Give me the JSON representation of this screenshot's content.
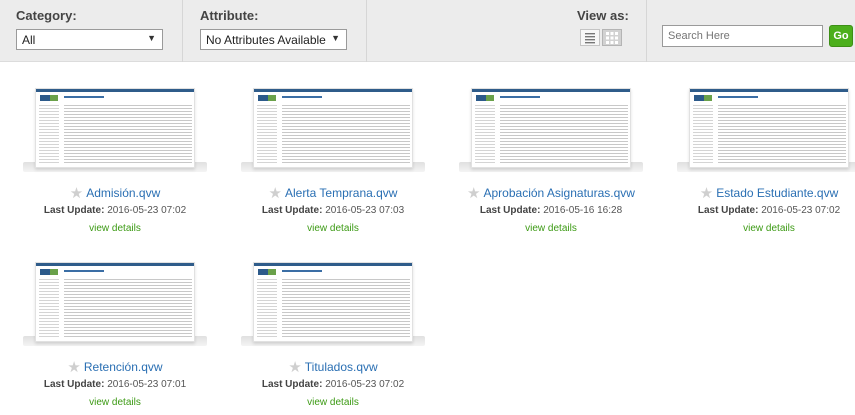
{
  "toolbar": {
    "category_label": "Category:",
    "category_value": "All",
    "attribute_label": "Attribute:",
    "attribute_value": "No Attributes Available",
    "view_as_label": "View as:",
    "view_modes": [
      "list-view-icon",
      "grid-view-icon"
    ],
    "active_view": "grid-view-icon",
    "search_placeholder": "Search Here",
    "go_label": "Go",
    "dropdown_arrow": "▼"
  },
  "card_common": {
    "last_update_label": "Last Update:",
    "details_label": "view details",
    "star_glyph": "★"
  },
  "documents": [
    {
      "name": "Admisión.qvw",
      "last_update": "2016-05-23 07:02"
    },
    {
      "name": "Alerta Temprana.qvw",
      "last_update": "2016-05-23 07:03"
    },
    {
      "name": "Aprobación Asignaturas.qvw",
      "last_update": "2016-05-16 16:28"
    },
    {
      "name": "Estado Estudiante.qvw",
      "last_update": "2016-05-23 07:02"
    },
    {
      "name": "Retención.qvw",
      "last_update": "2016-05-23 07:01"
    },
    {
      "name": "Titulados.qvw",
      "last_update": "2016-05-23 07:02"
    }
  ],
  "colors": {
    "toolbar_bg": "#ececec",
    "link_blue": "#2a6fb3",
    "details_green": "#3c9a14",
    "go_green": "#4caf1c"
  }
}
